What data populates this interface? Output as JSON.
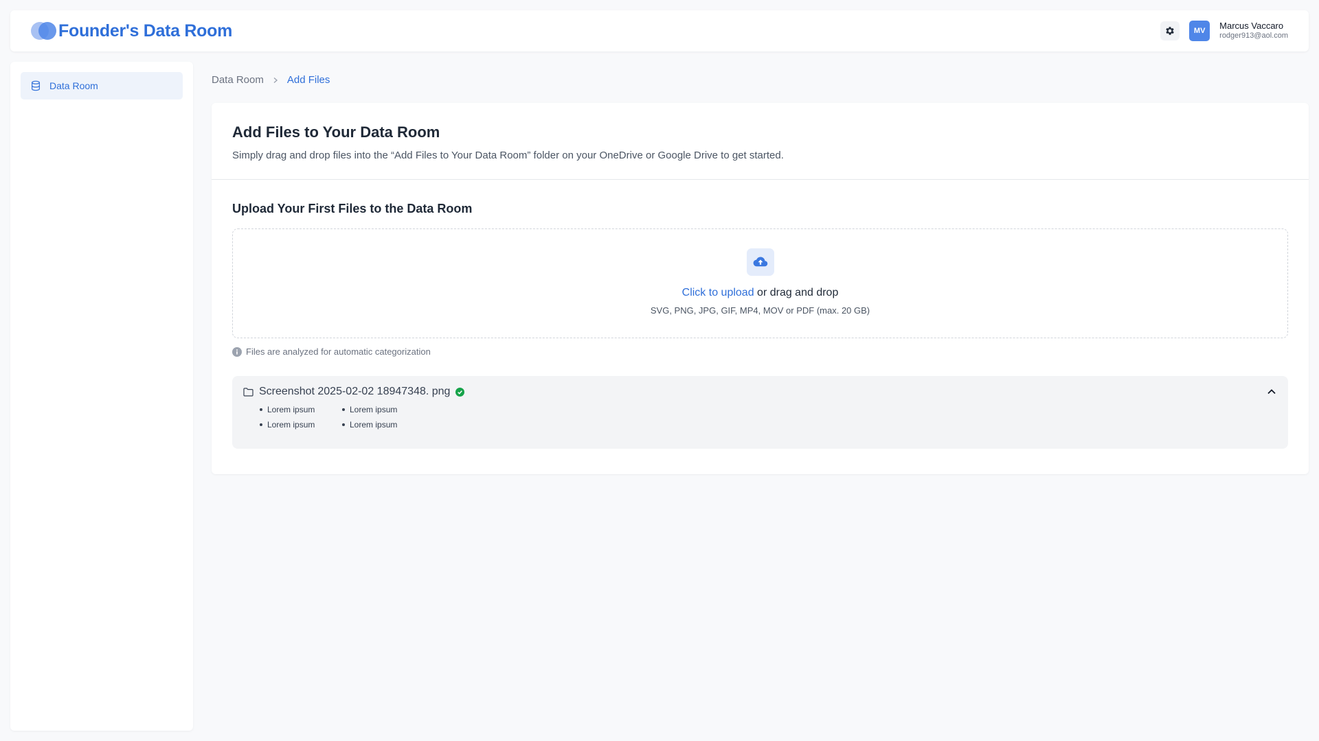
{
  "header": {
    "brand_title": "Founder's Data Room",
    "user": {
      "initials": "MV",
      "name": "Marcus Vaccaro",
      "email": "rodger913@aol.com"
    },
    "settings_icon": "gear-icon"
  },
  "sidebar": {
    "items": [
      {
        "label": "Data Room",
        "icon": "database-icon",
        "active": true
      }
    ]
  },
  "breadcrumb": {
    "items": [
      "Data Room",
      "Add Files"
    ]
  },
  "main": {
    "title": "Add Files to Your Data Room",
    "description": "Simply drag and drop files into the “Add Files to Your Data Room” folder on your OneDrive or Google Drive to get started.",
    "upload_section": {
      "title": "Upload Your First Files to the Data Room",
      "link_text": "Click to upload",
      "rest_text": " or drag and drop",
      "formats": "SVG, PNG, JPG, GIF, MP4, MOV or PDF (max. 20 GB)",
      "hint": "Files are analyzed for automatic categorization"
    },
    "uploaded_file": {
      "name": "Screenshot 2025-02-02 18947348. png",
      "status": "complete",
      "tags": [
        "Lorem ipsum",
        "Lorem ipsum",
        "Lorem ipsum",
        "Lorem ipsum"
      ]
    }
  },
  "colors": {
    "accent": "#2f6fd9",
    "success": "#16a34a",
    "background": "#f8f9fb"
  }
}
